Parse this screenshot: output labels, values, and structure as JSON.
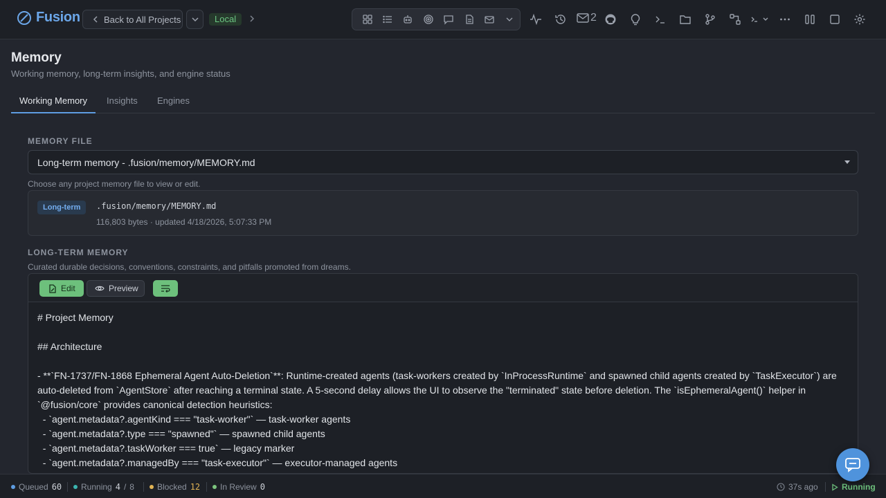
{
  "app": {
    "name": "Fusion"
  },
  "topbar": {
    "back_label": "Back to All Projects",
    "environment": "Local",
    "mail_count": "2",
    "view_icons": [
      "grid-icon",
      "list-icon",
      "robot-icon",
      "target-icon",
      "chat-icon",
      "document-icon",
      "mail-icon",
      "chevron-down-icon"
    ],
    "tool_icons": [
      "activity-icon",
      "history-icon",
      "mail-icon",
      "github-icon",
      "lightbulb-icon",
      "terminal-icon",
      "folder-icon",
      "git-branch-icon",
      "workflow-icon",
      "terminal-dropdown-icon",
      "more-icon",
      "columns-icon",
      "square-icon",
      "gear-icon"
    ]
  },
  "page": {
    "title": "Memory",
    "subtitle": "Working memory, long-term insights, and engine status",
    "tabs": [
      "Working Memory",
      "Insights",
      "Engines"
    ]
  },
  "memory_file": {
    "section_label": "MEMORY FILE",
    "selected": "Long-term memory - .fusion/memory/MEMORY.md",
    "hint": "Choose any project memory file to view or edit.",
    "badge": "Long-term",
    "path": ".fusion/memory/MEMORY.md",
    "meta": "116,803 bytes · updated 4/18/2026, 5:07:33 PM"
  },
  "long_term": {
    "section_label": "LONG-TERM MEMORY",
    "description": "Curated durable decisions, conventions, constraints, and pitfalls promoted from dreams.",
    "edit_label": "Edit",
    "preview_label": "Preview",
    "content": "# Project Memory\n\n## Architecture\n\n- **`FN-1737/FN-1868 Ephemeral Agent Auto-Deletion`**: Runtime-created agents (task-workers created by `InProcessRuntime` and spawned child agents created by `TaskExecutor`) are auto-deleted from `AgentStore` after reaching a terminal state. A 5-second delay allows the UI to observe the \"terminated\" state before deletion. The `isEphemeralAgent()` helper in `@fusion/core` provides canonical detection heuristics:\n  - `agent.metadata?.agentKind === \"task-worker\"` — task-worker agents\n  - `agent.metadata?.type === \"spawned\"` — spawned child agents\n  - `agent.metadata?.taskWorker === true` — legacy marker\n  - `agent.metadata?.managedBy === \"task-executor\"` — executor-managed agents"
  },
  "status": {
    "queued_label": "Queued",
    "queued": "60",
    "running_label": "Running",
    "running": "4",
    "running_sep": "/",
    "running_max": "8",
    "blocked_label": "Blocked",
    "blocked": "12",
    "review_label": "In Review",
    "review": "0",
    "last_update": "37s ago",
    "engine_state": "Running"
  },
  "colors": {
    "accent": "#5e9de2",
    "success": "#6dc07c",
    "warning": "#e0b354",
    "queued": "#5e9de2",
    "running": "#3bb5b0",
    "review": "#7cc47e"
  }
}
